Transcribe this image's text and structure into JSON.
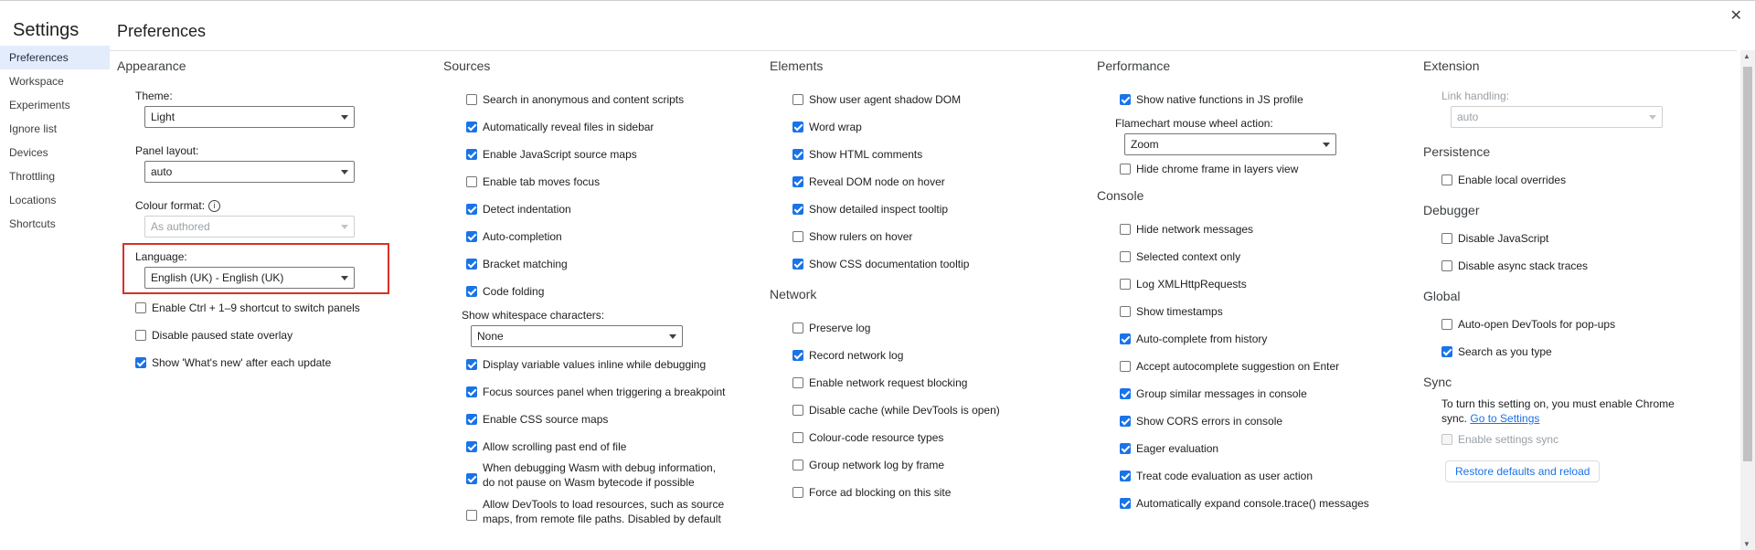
{
  "window": {
    "settings_title": "Settings",
    "page_title": "Preferences",
    "close": "✕"
  },
  "sidebar": {
    "items": [
      {
        "label": "Preferences",
        "active": true
      },
      {
        "label": "Workspace"
      },
      {
        "label": "Experiments"
      },
      {
        "label": "Ignore list"
      },
      {
        "label": "Devices"
      },
      {
        "label": "Throttling"
      },
      {
        "label": "Locations"
      },
      {
        "label": "Shortcuts"
      }
    ]
  },
  "appearance": {
    "title": "Appearance",
    "theme_label": "Theme:",
    "theme_value": "Light",
    "panel_layout_label": "Panel layout:",
    "panel_layout_value": "auto",
    "colour_format_label": "Colour format:",
    "colour_format_value": "As authored",
    "language_label": "Language:",
    "language_value": "English (UK) - English (UK)",
    "checkboxes": [
      {
        "label": "Enable Ctrl + 1–9 shortcut to switch panels",
        "checked": false
      },
      {
        "label": "Disable paused state overlay",
        "checked": false
      },
      {
        "label": "Show 'What's new' after each update",
        "checked": true
      }
    ]
  },
  "sources": {
    "title": "Sources",
    "checkboxes_a": [
      {
        "label": "Search in anonymous and content scripts",
        "checked": false
      },
      {
        "label": "Automatically reveal files in sidebar",
        "checked": true
      },
      {
        "label": "Enable JavaScript source maps",
        "checked": true
      },
      {
        "label": "Enable tab moves focus",
        "checked": false
      },
      {
        "label": "Detect indentation",
        "checked": true
      },
      {
        "label": "Auto-completion",
        "checked": true
      },
      {
        "label": "Bracket matching",
        "checked": true
      },
      {
        "label": "Code folding",
        "checked": true
      }
    ],
    "whitespace_label": "Show whitespace characters:",
    "whitespace_value": "None",
    "checkboxes_b": [
      {
        "label": "Display variable values inline while debugging",
        "checked": true
      },
      {
        "label": "Focus sources panel when triggering a breakpoint",
        "checked": true
      },
      {
        "label": "Enable CSS source maps",
        "checked": true
      },
      {
        "label": "Allow scrolling past end of file",
        "checked": true
      }
    ],
    "wasm_line1": "When debugging Wasm with debug information,",
    "wasm_line2": "do not pause on Wasm bytecode if possible",
    "devtools_line1": "Allow DevTools to load resources, such as source",
    "devtools_line2": "maps, from remote file paths. Disabled by default"
  },
  "elements": {
    "title": "Elements",
    "checkboxes": [
      {
        "label": "Show user agent shadow DOM",
        "checked": false
      },
      {
        "label": "Word wrap",
        "checked": true
      },
      {
        "label": "Show HTML comments",
        "checked": true
      },
      {
        "label": "Reveal DOM node on hover",
        "checked": true
      },
      {
        "label": "Show detailed inspect tooltip",
        "checked": true
      },
      {
        "label": "Show rulers on hover",
        "checked": false
      },
      {
        "label": "Show CSS documentation tooltip",
        "checked": true
      }
    ]
  },
  "network": {
    "title": "Network",
    "checkboxes": [
      {
        "label": "Preserve log",
        "checked": false
      },
      {
        "label": "Record network log",
        "checked": true
      },
      {
        "label": "Enable network request blocking",
        "checked": false
      },
      {
        "label": "Disable cache (while DevTools is open)",
        "checked": false
      },
      {
        "label": "Colour-code resource types",
        "checked": false
      },
      {
        "label": "Group network log by frame",
        "checked": false
      },
      {
        "label": "Force ad blocking on this site",
        "checked": false
      }
    ]
  },
  "performance": {
    "title": "Performance",
    "native_fn_label": "Show native functions in JS profile",
    "flamechart_label": "Flamechart mouse wheel action:",
    "flamechart_value": "Zoom",
    "hide_chrome_label": "Hide chrome frame in layers view"
  },
  "console": {
    "title": "Console",
    "checkboxes": [
      {
        "label": "Hide network messages",
        "checked": false
      },
      {
        "label": "Selected context only",
        "checked": false
      },
      {
        "label": "Log XMLHttpRequests",
        "checked": false
      },
      {
        "label": "Show timestamps",
        "checked": false
      },
      {
        "label": "Auto-complete from history",
        "checked": true
      },
      {
        "label": "Accept autocomplete suggestion on Enter",
        "checked": false
      },
      {
        "label": "Group similar messages in console",
        "checked": true
      },
      {
        "label": "Show CORS errors in console",
        "checked": true
      },
      {
        "label": "Eager evaluation",
        "checked": true
      },
      {
        "label": "Treat code evaluation as user action",
        "checked": true
      },
      {
        "label": "Automatically expand console.trace() messages",
        "checked": true
      }
    ]
  },
  "extension": {
    "title": "Extension",
    "link_handling_label": "Link handling:",
    "link_handling_value": "auto"
  },
  "persistence": {
    "title": "Persistence",
    "local_overrides_label": "Enable local overrides"
  },
  "debugger": {
    "title": "Debugger",
    "disable_js_label": "Disable JavaScript",
    "disable_async_label": "Disable async stack traces"
  },
  "global": {
    "title": "Global",
    "auto_open_label": "Auto-open DevTools for pop-ups",
    "search_as_type_label": "Search as you type"
  },
  "sync": {
    "title": "Sync",
    "text": "To turn this setting on, you must enable Chrome sync.",
    "link": "Go to Settings",
    "enable_label": "Enable settings sync",
    "restore_button": "Restore defaults and reload"
  },
  "colors": {
    "accent": "#1a73e8",
    "highlight_border": "#d93025",
    "active_nav": "#e3ecfb"
  }
}
